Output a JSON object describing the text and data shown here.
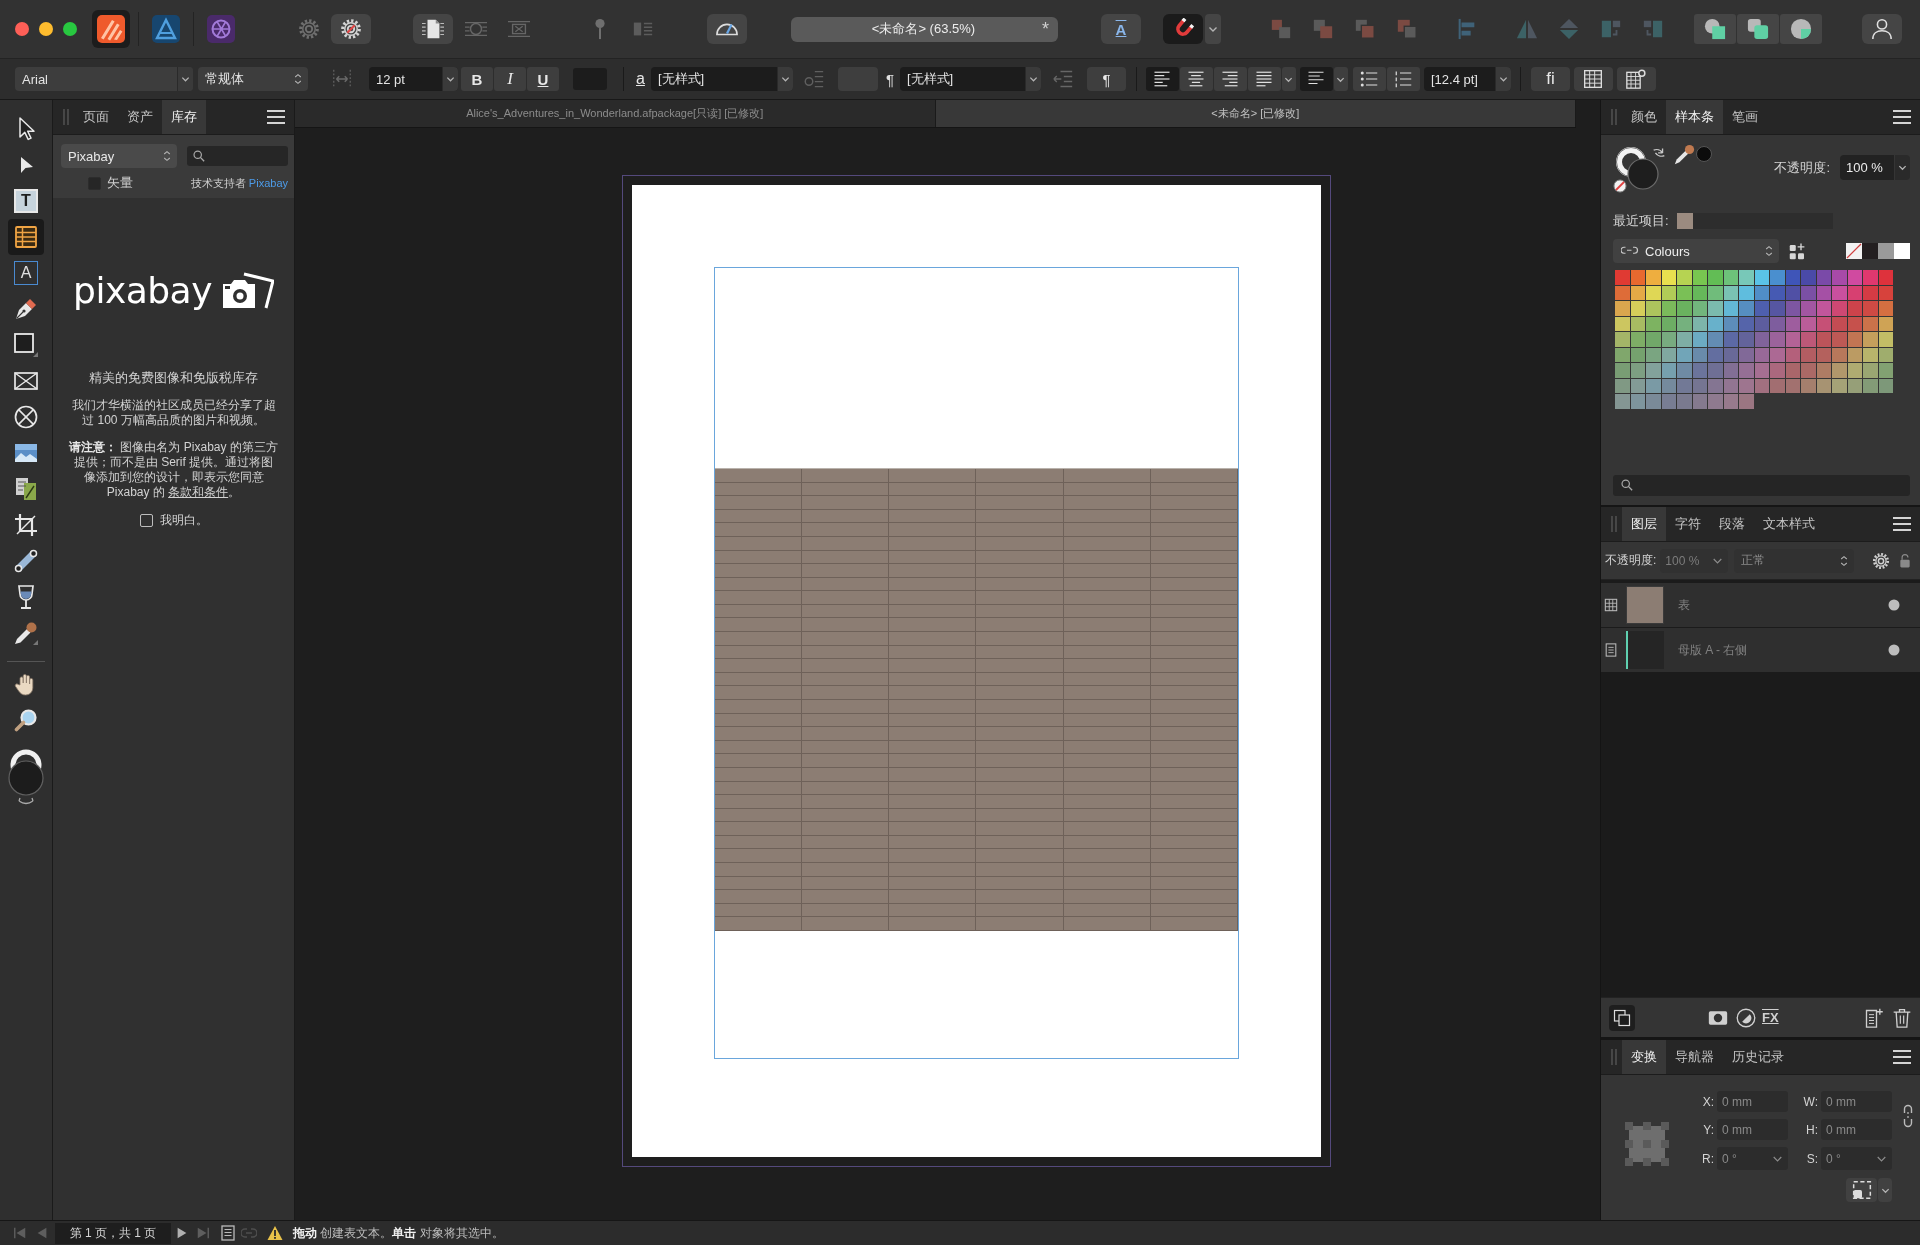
{
  "app_switcher": [
    {
      "kind": "publisher",
      "selected": true
    },
    {
      "kind": "designer",
      "selected": false
    },
    {
      "kind": "photo",
      "selected": false
    }
  ],
  "toolbar": {
    "document_title": "<未命名> (63.5%)",
    "modified_mark": "*",
    "text_frame_glyph": "A",
    "snapping": true
  },
  "context_toolbar": {
    "font": "Arial",
    "font_style": "常规体",
    "font_size": "12 pt",
    "bold": "B",
    "italic": "I",
    "underline": "U",
    "character_glyph": "a",
    "character_style": "[无样式]",
    "pilcrow_glyph": "¶",
    "paragraph_style": "[无样式]",
    "pilcrow_button": "¶",
    "alignment": [
      {
        "kind": "left",
        "selected": true
      },
      {
        "kind": "center",
        "selected": false
      },
      {
        "kind": "right",
        "selected": false
      },
      {
        "kind": "justify",
        "selected": false
      }
    ],
    "leading": "[12.4 pt]",
    "ligature_button": "fi"
  },
  "document_tabs": [
    {
      "title": "Alice's_Adventures_in_Wonderland.afpackage[只读] [已修改]",
      "selected": false
    },
    {
      "title": "<未命名> [已修改]",
      "selected": true
    }
  ],
  "tools": [
    {
      "kind": "move",
      "selected": false
    },
    {
      "kind": "node",
      "selected": false
    },
    {
      "kind": "frame_text",
      "glyph": "T",
      "selected": false
    },
    {
      "kind": "table",
      "selected": true
    },
    {
      "kind": "artistic_text",
      "glyph": "A",
      "selected": false
    },
    {
      "kind": "pen",
      "selected": false
    },
    {
      "kind": "rectangle",
      "selected": false
    },
    {
      "kind": "picture_frame",
      "selected": false
    },
    {
      "kind": "ellipse_frame",
      "selected": false
    },
    {
      "kind": "place_image",
      "selected": false
    },
    {
      "kind": "image_pages",
      "selected": false
    },
    {
      "kind": "crop",
      "selected": false
    },
    {
      "kind": "fill",
      "selected": false
    },
    {
      "kind": "transparency",
      "selected": false
    },
    {
      "kind": "color_picker",
      "selected": false
    }
  ],
  "view_tools": [
    {
      "kind": "hand",
      "selected": false
    },
    {
      "kind": "zoom",
      "selected": false
    }
  ],
  "left_panel": {
    "tabs": [
      {
        "label": "页面",
        "selected": false
      },
      {
        "label": "资产",
        "selected": false
      },
      {
        "label": "库存",
        "selected": true
      }
    ],
    "source": "Pixabay",
    "vector_filter": {
      "label": "矢量",
      "checked": false
    },
    "credit": "技术支持者",
    "credit_link": "Pixabay",
    "logo": "pixabay",
    "headline": "精美的免费图像和免版税库存",
    "intro": "我们才华横溢的社区成员已经分享了超过 100 万幅高品质的图片和视频。",
    "notice": "**请注意：** 图像由名为 Pixabay 的第三方提供；而不是由 Serif 提供。通过将图像添加到您的设计，即表示您同意 Pixabay 的 ",
    "terms_link": "条款和条件",
    "notice_end": "。",
    "agree": {
      "label": "我明白。",
      "checked": false
    }
  },
  "swatches_panel": {
    "tabs": [
      {
        "label": "颜色",
        "selected": false
      },
      {
        "label": "样本条",
        "selected": true
      },
      {
        "label": "笔画",
        "selected": false
      }
    ],
    "opacity_label": "不透明度:",
    "opacity": "100 %",
    "recent_label": "最近项目:",
    "recent": [
      {
        "color": "#9b8b80"
      }
    ],
    "palette": "Colours",
    "quick_swatches": [
      {
        "kind": "none"
      },
      {
        "kind": "solid",
        "color": "#231f20"
      },
      {
        "kind": "solid",
        "color": "#9a9a9a"
      },
      {
        "kind": "solid",
        "color": "#ffffff"
      }
    ],
    "swatches": [
      {
        "color": "#e03a33"
      },
      {
        "color": "#e8692f"
      },
      {
        "color": "#eeae3f"
      },
      {
        "color": "#e9e04f"
      },
      {
        "color": "#b6d352"
      },
      {
        "color": "#78c650"
      },
      {
        "color": "#62bd55"
      },
      {
        "color": "#6dc27a"
      },
      {
        "color": "#78c8b8"
      },
      {
        "color": "#5ac3e8"
      },
      {
        "color": "#4a8fcf"
      },
      {
        "color": "#3f55b8"
      },
      {
        "color": "#4a4aa8"
      },
      {
        "color": "#7a4aa8"
      },
      {
        "color": "#a84aa8"
      },
      {
        "color": "#d04aa0"
      },
      {
        "color": "#e0386e"
      },
      {
        "color": "#de323c"
      },
      {
        "color": "#de6c38"
      },
      {
        "color": "#e4aa46"
      },
      {
        "color": "#dfd755"
      },
      {
        "color": "#b1cc57"
      },
      {
        "color": "#7ac056"
      },
      {
        "color": "#66b85a"
      },
      {
        "color": "#70bc7b"
      },
      {
        "color": "#7ac2b3"
      },
      {
        "color": "#5fbdde"
      },
      {
        "color": "#508ec8"
      },
      {
        "color": "#465ab3"
      },
      {
        "color": "#5050a5"
      },
      {
        "color": "#7b50a5"
      },
      {
        "color": "#a550a5"
      },
      {
        "color": "#c9509e"
      },
      {
        "color": "#d74071"
      },
      {
        "color": "#d53b44"
      },
      {
        "color": "#d7423c"
      },
      {
        "color": "#daa64e"
      },
      {
        "color": "#d6ce5a"
      },
      {
        "color": "#adc45d"
      },
      {
        "color": "#7bba5b"
      },
      {
        "color": "#6ab25f"
      },
      {
        "color": "#72b67d"
      },
      {
        "color": "#7bbbae"
      },
      {
        "color": "#63b7d5"
      },
      {
        "color": "#568ec1"
      },
      {
        "color": "#4e5fae"
      },
      {
        "color": "#5656a2"
      },
      {
        "color": "#7d56a2"
      },
      {
        "color": "#a256a2"
      },
      {
        "color": "#c2569b"
      },
      {
        "color": "#ce4873"
      },
      {
        "color": "#cd434b"
      },
      {
        "color": "#ce4a44"
      },
      {
        "color": "#d56f41"
      },
      {
        "color": "#ccc660"
      },
      {
        "color": "#a8bc62"
      },
      {
        "color": "#7db361"
      },
      {
        "color": "#6dad64"
      },
      {
        "color": "#75b17e"
      },
      {
        "color": "#7db5aa"
      },
      {
        "color": "#68b1cb"
      },
      {
        "color": "#5d8dba"
      },
      {
        "color": "#5564aa"
      },
      {
        "color": "#5d5d9e"
      },
      {
        "color": "#7e5d9e"
      },
      {
        "color": "#9e5d9e"
      },
      {
        "color": "#ba5d99"
      },
      {
        "color": "#c65076"
      },
      {
        "color": "#c44c53"
      },
      {
        "color": "#c6514c"
      },
      {
        "color": "#cb724a"
      },
      {
        "color": "#cfa355"
      },
      {
        "color": "#a4b568"
      },
      {
        "color": "#7ead66"
      },
      {
        "color": "#71a869"
      },
      {
        "color": "#78ab80"
      },
      {
        "color": "#7eaea5"
      },
      {
        "color": "#6cabc2"
      },
      {
        "color": "#638cb3"
      },
      {
        "color": "#5c69a5"
      },
      {
        "color": "#63639b"
      },
      {
        "color": "#80639b"
      },
      {
        "color": "#9b639b"
      },
      {
        "color": "#b36396"
      },
      {
        "color": "#bd5878"
      },
      {
        "color": "#bc545a"
      },
      {
        "color": "#bd5955"
      },
      {
        "color": "#c27553"
      },
      {
        "color": "#c59f5c"
      },
      {
        "color": "#c2bd66"
      },
      {
        "color": "#80a76c"
      },
      {
        "color": "#75a26e"
      },
      {
        "color": "#7aa581"
      },
      {
        "color": "#80a8a0"
      },
      {
        "color": "#71a5b8"
      },
      {
        "color": "#698bab"
      },
      {
        "color": "#636ea0"
      },
      {
        "color": "#696998"
      },
      {
        "color": "#816998"
      },
      {
        "color": "#986998"
      },
      {
        "color": "#ac6994"
      },
      {
        "color": "#b4607b"
      },
      {
        "color": "#b35d62"
      },
      {
        "color": "#b4615d"
      },
      {
        "color": "#b8785b"
      },
      {
        "color": "#bb9b63"
      },
      {
        "color": "#b8b46b"
      },
      {
        "color": "#9fad6d"
      },
      {
        "color": "#799d74"
      },
      {
        "color": "#7d9f82"
      },
      {
        "color": "#82a29b"
      },
      {
        "color": "#76a0ae"
      },
      {
        "color": "#6f8ba4"
      },
      {
        "color": "#6b749b"
      },
      {
        "color": "#6f6f95"
      },
      {
        "color": "#826f95"
      },
      {
        "color": "#956f95"
      },
      {
        "color": "#a56f92"
      },
      {
        "color": "#ab687e"
      },
      {
        "color": "#aa666a"
      },
      {
        "color": "#ab6966"
      },
      {
        "color": "#ae7c64"
      },
      {
        "color": "#b1976b"
      },
      {
        "color": "#afab71"
      },
      {
        "color": "#9aa672"
      },
      {
        "color": "#82a172"
      },
      {
        "color": "#809984"
      },
      {
        "color": "#839b96"
      },
      {
        "color": "#7a9aa5"
      },
      {
        "color": "#758a9d"
      },
      {
        "color": "#727996"
      },
      {
        "color": "#757592"
      },
      {
        "color": "#847592"
      },
      {
        "color": "#927592"
      },
      {
        "color": "#9e758f"
      },
      {
        "color": "#a27080"
      },
      {
        "color": "#a26e71"
      },
      {
        "color": "#a2716f"
      },
      {
        "color": "#a57f6d"
      },
      {
        "color": "#a79372"
      },
      {
        "color": "#a5a277"
      },
      {
        "color": "#969f78"
      },
      {
        "color": "#839b77"
      },
      {
        "color": "#7d9879"
      },
      {
        "color": "#849693"
      },
      {
        "color": "#7e959d"
      },
      {
        "color": "#7a8a98"
      },
      {
        "color": "#787d93"
      },
      {
        "color": "#7a7a8f"
      },
      {
        "color": "#857a8f"
      },
      {
        "color": "#8f7a8f"
      },
      {
        "color": "#987a8d"
      },
      {
        "color": "#9b7682"
      }
    ]
  },
  "layers_panel": {
    "tabs": [
      {
        "label": "图层",
        "selected": true
      },
      {
        "label": "字符",
        "selected": false
      },
      {
        "label": "段落",
        "selected": false
      },
      {
        "label": "文本样式",
        "selected": false
      }
    ],
    "opacity_label": "不透明度:",
    "opacity": {
      "value": "100 %",
      "disabled": true
    },
    "blend_mode": "正常",
    "layers": [
      {
        "kind": "table",
        "name": "表",
        "selected": false,
        "visible": true
      },
      {
        "kind": "master",
        "name": "母版 A - 右侧",
        "selected": false,
        "visible": true
      }
    ],
    "effects_button": "FX"
  },
  "transform_panel": {
    "tabs": [
      {
        "label": "变换",
        "selected": true
      },
      {
        "label": "导航器",
        "selected": false
      },
      {
        "label": "历史记录",
        "selected": false
      }
    ],
    "fields": [
      {
        "label": "X:",
        "value": "0 mm",
        "kind": "text"
      },
      {
        "label": "W:",
        "value": "0 mm",
        "kind": "text"
      },
      {
        "label": "Y:",
        "value": "0 mm",
        "kind": "text"
      },
      {
        "label": "H:",
        "value": "0 mm",
        "kind": "text"
      },
      {
        "label": "R:",
        "value": "0 °",
        "kind": "dropdown"
      },
      {
        "label": "S:",
        "value": "0 °",
        "kind": "dropdown"
      }
    ]
  },
  "status_bar": {
    "page": "第 1 页，共 1 页",
    "hint": "**拖动** 创建表文本。**单击** 对象将其选中。"
  }
}
